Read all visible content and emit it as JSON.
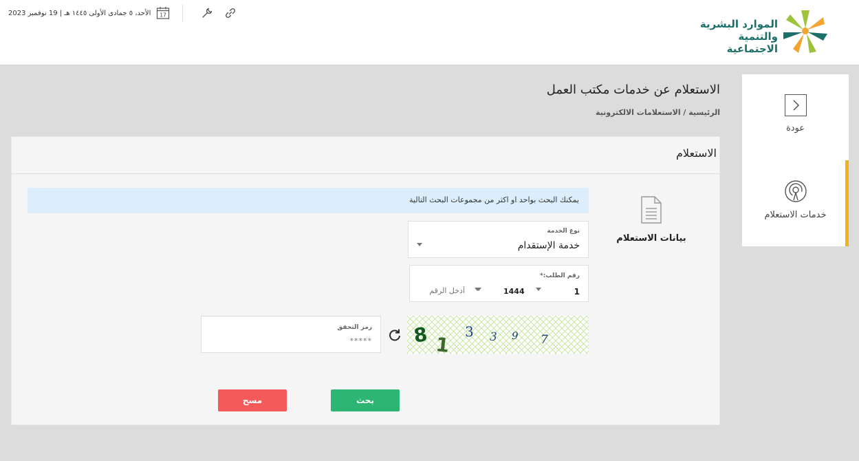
{
  "header": {
    "org_name_line1": "الموارد البشرية",
    "org_name_line2": "والتنمية الاجتماعية",
    "date_text": "الأحد، ٥ جمادى الأولى ١٤٤٥ هـ | 19 نوفمبر 2023",
    "calendar_day": "17",
    "brand_colors": {
      "teal": "#1d6f6a",
      "green": "#9cc33b",
      "orange": "#f2a531"
    }
  },
  "sidebar": {
    "back_label": "عودة",
    "services_label": "خدمات الاستعلام",
    "accent_color": "#f2b318"
  },
  "page": {
    "title": "الاستعلام عن خدمات مكتب العمل",
    "breadcrumb": "الرئيسية / الاستعلامات الالكترونية"
  },
  "card": {
    "title": "الاستعلام",
    "section_label": "بيانات الاستعلام",
    "info_message": "يمكنك البحث بواحد او اكثر من مجموعات البحث التالية"
  },
  "form": {
    "service_type_label": "نوع الخدمة",
    "service_type_value": "خدمة الإستقدام",
    "order_number_label": "رقم الطلب:*",
    "order_sequence_value": "1",
    "order_year_value": "1444",
    "order_number_placeholder": "أدخل الرقم",
    "captcha_digits": [
      "8",
      "1",
      "3",
      "3",
      "9",
      "7"
    ],
    "verification_label": "رمز التحقق",
    "verification_placeholder": "*****"
  },
  "actions": {
    "search_label": "بحث",
    "clear_label": "مسح",
    "search_color": "#2db573",
    "clear_color": "#f45a5a"
  }
}
